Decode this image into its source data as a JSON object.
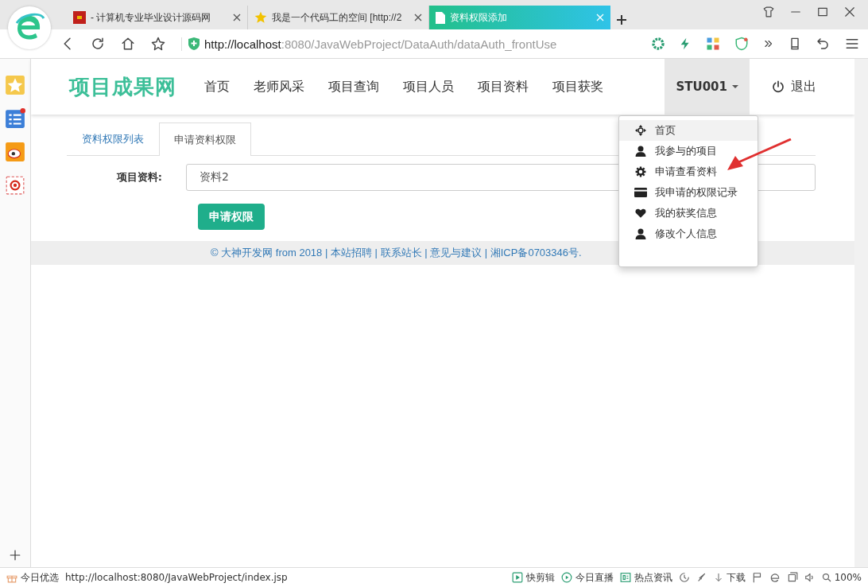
{
  "browser": {
    "tabs": [
      {
        "title": "- 计算机专业毕业设计源码网",
        "selected": false
      },
      {
        "title": "我是一个代码工的空间 [http://2",
        "selected": false
      },
      {
        "title": "资料权限添加",
        "selected": true
      }
    ],
    "address": {
      "host": "http://localhost",
      "rest": ":8080/JavaWebProject/DataAuth/dataAuth_frontUse"
    }
  },
  "site": {
    "logo": "项目成果网",
    "nav": [
      {
        "label": "首页",
        "selected": false
      },
      {
        "label": "老师风采",
        "selected": false
      },
      {
        "label": "项目查询",
        "selected": false
      },
      {
        "label": "项目人员",
        "selected": false
      },
      {
        "label": "项目资料",
        "selected": false
      },
      {
        "label": "项目获奖",
        "selected": false
      }
    ],
    "user": {
      "label": "STU001",
      "expanded": true
    },
    "logout": "退出",
    "tabs": [
      {
        "label": "资料权限列表",
        "selected": false
      },
      {
        "label": "申请资料权限",
        "selected": true
      }
    ],
    "form": {
      "label": "项目资料:",
      "value": "资料2",
      "button": "申请权限"
    },
    "footer": "© 大神开发网 from 2018 | 本站招聘 | 联系站长 | 意见与建议 | 湘ICP备0703346号.",
    "menu": [
      {
        "label": "首页",
        "kind": "move",
        "selected": true
      },
      {
        "label": "我参与的项目",
        "kind": "user",
        "selected": false
      },
      {
        "label": "申请查看资料",
        "kind": "gear",
        "selected": false
      },
      {
        "label": "我申请的权限记录",
        "kind": "card",
        "selected": false
      },
      {
        "label": "我的获奖信息",
        "kind": "heart",
        "selected": false
      },
      {
        "label": "修改个人信息",
        "kind": "user",
        "selected": false
      }
    ]
  },
  "status_bar": {
    "left": "今日优选",
    "url": "http://localhost:8080/JavaWebProject/index.jsp",
    "items": [
      "快剪辑",
      "今日直播",
      "热点资讯"
    ],
    "download": "下载",
    "zoom": "100%"
  }
}
